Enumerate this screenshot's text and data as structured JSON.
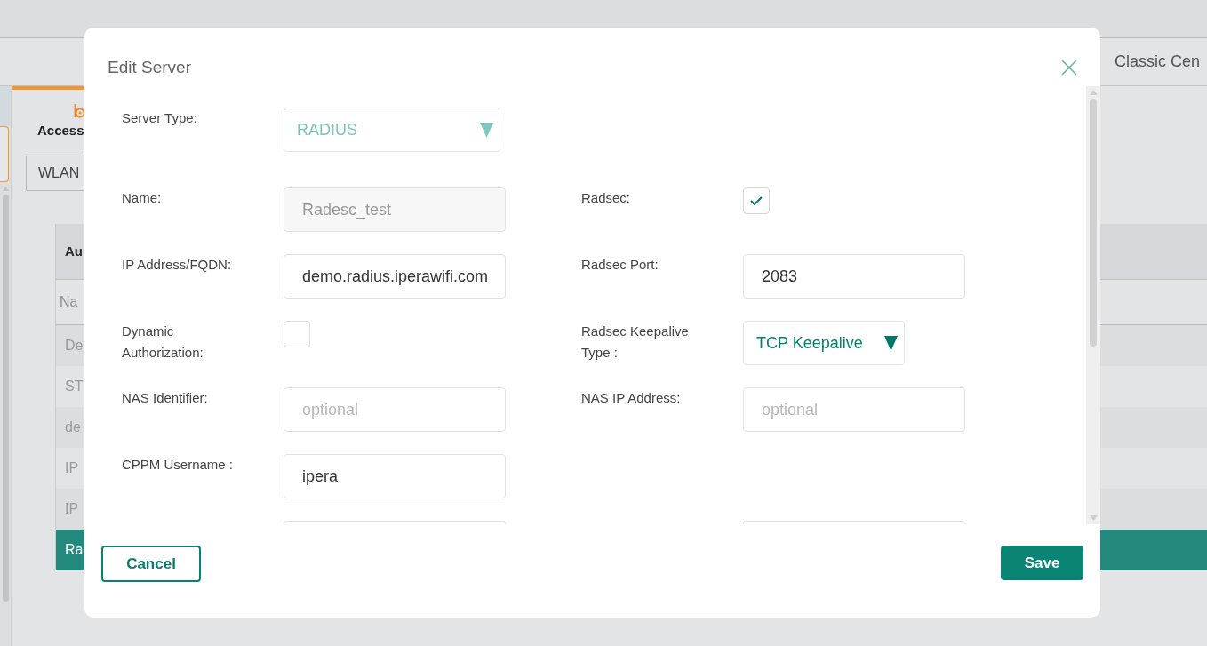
{
  "page": {
    "header_tab": "Classic Cen",
    "panel_title": "Access",
    "filter_select": {
      "value": "WLAN"
    },
    "table": {
      "title": "Au",
      "columns": [
        "Na"
      ],
      "rows": [
        {
          "cells": [
            "De"
          ],
          "selected": false
        },
        {
          "cells": [
            "ST"
          ],
          "selected": false
        },
        {
          "cells": [
            "de"
          ],
          "selected": false
        },
        {
          "cells": [
            "IP"
          ],
          "selected": false
        },
        {
          "cells": [
            "IP"
          ],
          "selected": false
        },
        {
          "cells": [
            "Ra"
          ],
          "selected": true
        }
      ]
    }
  },
  "dialog": {
    "title": "Edit Server",
    "rows": [
      {
        "cut_off": false,
        "left": {
          "label": "Server Type:",
          "kind": "select",
          "value": "RADIUS",
          "disabled": true
        }
      },
      {
        "cut_off": false,
        "left": {
          "label": "Name:",
          "kind": "text",
          "value": "Radesc_test",
          "disabled": true
        },
        "right": {
          "label": "Radsec:",
          "kind": "checkbox",
          "checked": true
        }
      },
      {
        "cut_off": false,
        "left": {
          "label": "IP Address/FQDN:",
          "kind": "text",
          "value": "demo.radius.iperawifi.com",
          "disabled": false
        },
        "right": {
          "label": "Radsec Port:",
          "kind": "text",
          "value": "2083",
          "disabled": false
        }
      },
      {
        "cut_off": false,
        "left": {
          "label": "Dynamic Authorization:",
          "kind": "checkbox",
          "checked": false
        },
        "right": {
          "label": "Radsec Keepalive Type :",
          "kind": "select",
          "value": "TCP Keepalive",
          "disabled": false
        }
      },
      {
        "cut_off": false,
        "left": {
          "label": "NAS Identifier:",
          "kind": "text",
          "placeholder": "optional",
          "disabled": false
        },
        "right": {
          "label": "NAS IP Address:",
          "kind": "text",
          "placeholder": "optional",
          "disabled": false
        }
      },
      {
        "cut_off": false,
        "left": {
          "label": "CPPM Username :",
          "kind": "text",
          "value": "ipera",
          "disabled": false
        }
      },
      {
        "cut_off": true,
        "left": {
          "kind": "text"
        },
        "right": {
          "kind": "text"
        }
      }
    ],
    "buttons": [
      {
        "label": "Cancel",
        "kind": "secondary"
      },
      {
        "label": "Save",
        "kind": "primary"
      }
    ]
  }
}
